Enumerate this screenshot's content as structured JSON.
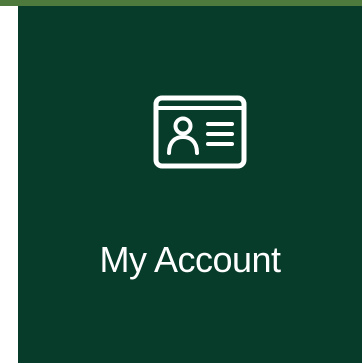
{
  "tile": {
    "label": "My Account",
    "icon": "id-card-icon",
    "background_color": "#073b2a",
    "accent_color": "#4e7a3e",
    "text_color": "#ffffff"
  }
}
